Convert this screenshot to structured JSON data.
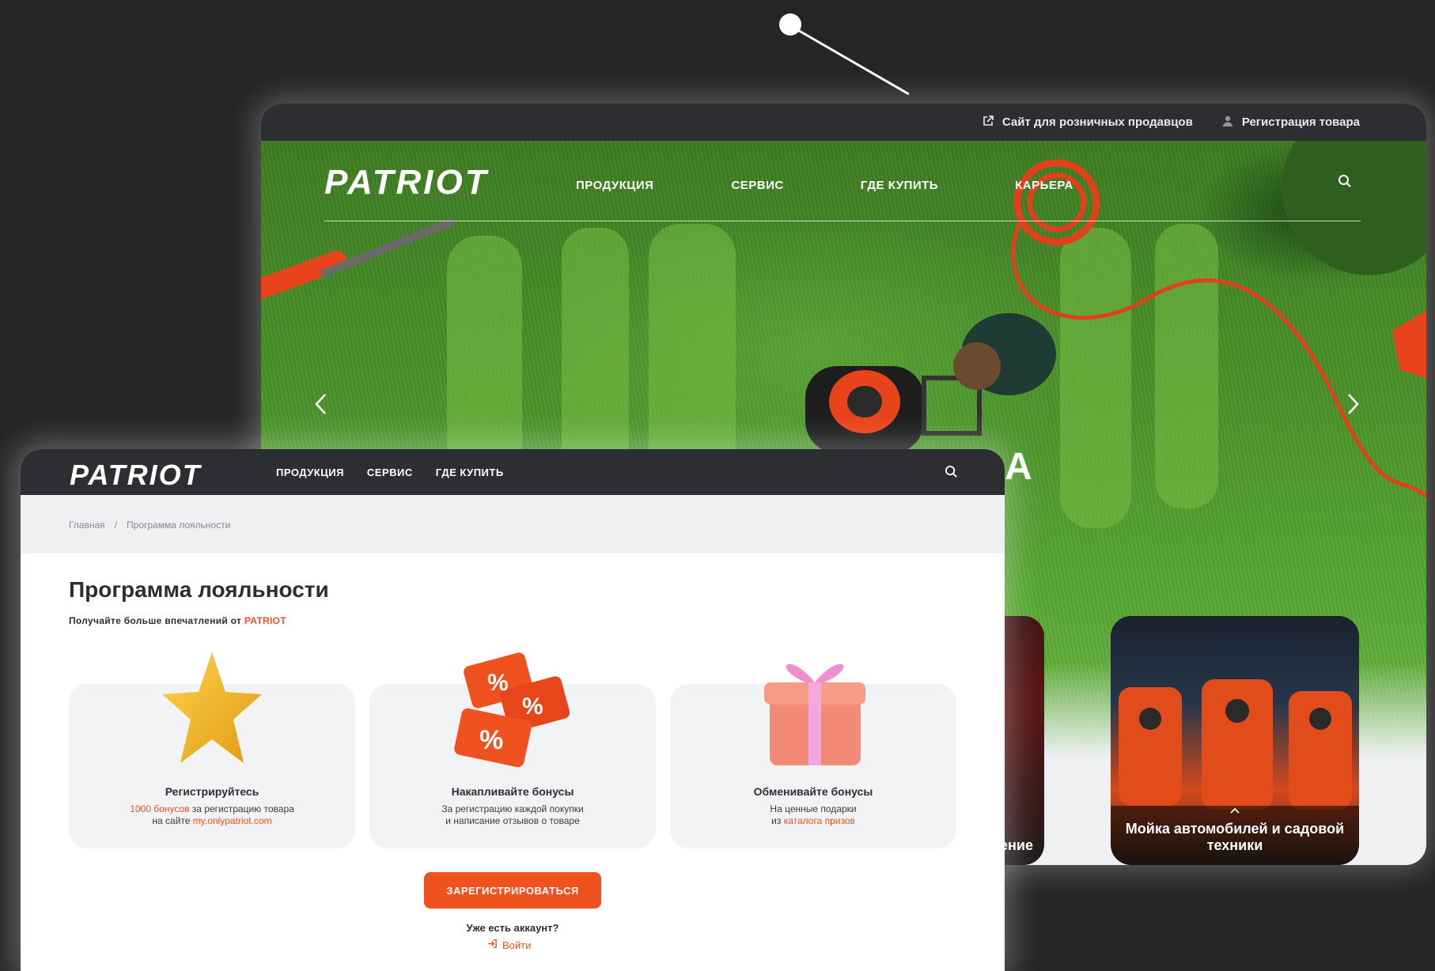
{
  "colors": {
    "accent": "#f0521f",
    "dark": "#2d2e31",
    "background": "#252526"
  },
  "back_window": {
    "topbar": {
      "retail_link": "Сайт для розничных продавцов",
      "register_product": "Регистрация товара"
    },
    "logo": "PATRIOT",
    "nav": [
      "ПРОДУКЦИЯ",
      "СЕРВИС",
      "ГДЕ КУПИТЬ",
      "КАРЬЕРА"
    ],
    "hero_partial_text": "А",
    "cards": {
      "left_caption": "абжение",
      "right_caption": "Мойка автомобилей и садовой техники"
    }
  },
  "front_window": {
    "logo": "PATRIOT",
    "nav": [
      "ПРОДУКЦИЯ",
      "СЕРВИС",
      "ГДЕ КУПИТЬ"
    ],
    "breadcrumb": {
      "home": "Главная",
      "separator": "/",
      "current": "Программа лояльности"
    },
    "title": "Программа лояльности",
    "subtitle_prefix": "Получайте больше впечатлений от",
    "subtitle_brand": "PATRIOT",
    "benefits": [
      {
        "title": "Регистрируйтесь",
        "highlight": "1000 бонусов",
        "line1_rest": "за регистрацию товара",
        "line2_prefix": "на сайте",
        "link": "my.onlypatriot.com",
        "icon": "star-icon"
      },
      {
        "title": "Накапливайте бонусы",
        "line1": "За регистрацию каждой покупки",
        "line2": "и написание отзывов о товаре",
        "icon": "percent-icon"
      },
      {
        "title": "Обменивайте бонусы",
        "line1": "На ценные подарки",
        "line2_prefix": "из",
        "link": "каталога призов",
        "icon": "gift-icon"
      }
    ],
    "register_button": "ЗАРЕГИСТРИРОВАТЬСЯ",
    "have_account": "Уже есть аккаунт?",
    "login": "Войти"
  }
}
